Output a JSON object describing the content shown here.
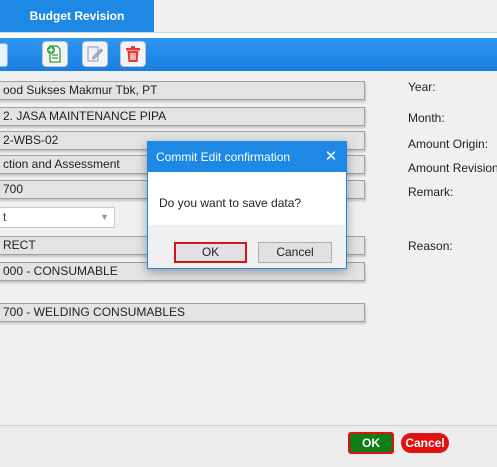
{
  "tabs": {
    "active_label": "Budget Revision"
  },
  "toolbar": {
    "buttons": [
      "add-document",
      "edit-document",
      "delete"
    ]
  },
  "form": {
    "fields": [
      "ood Sukses Makmur Tbk, PT",
      "2. JASA MAINTENANCE PIPA",
      "2-WBS-02",
      "ction and Assessment",
      "700",
      "RECT",
      "000 - CONSUMABLE",
      "700 - WELDING CONSUMABLES"
    ],
    "combo_value": "t"
  },
  "right_labels": {
    "year": "Year:",
    "month": "Month:",
    "amount_origin": "Amount Origin:",
    "amount_revision": "Amount Revision",
    "remark": "Remark:",
    "reason": "Reason:"
  },
  "dialog": {
    "title": "Commit Edit confirmation",
    "close": "✕",
    "message": "Do you want to save data?",
    "ok_label": "OK",
    "cancel_label": "Cancel"
  },
  "footer": {
    "ok_label": "OK",
    "cancel_label": "Cancel"
  },
  "colors": {
    "accent": "#1e88e5",
    "ok_green": "#0f7d16",
    "cancel_red": "#e31010",
    "highlight": "#d8141c"
  }
}
